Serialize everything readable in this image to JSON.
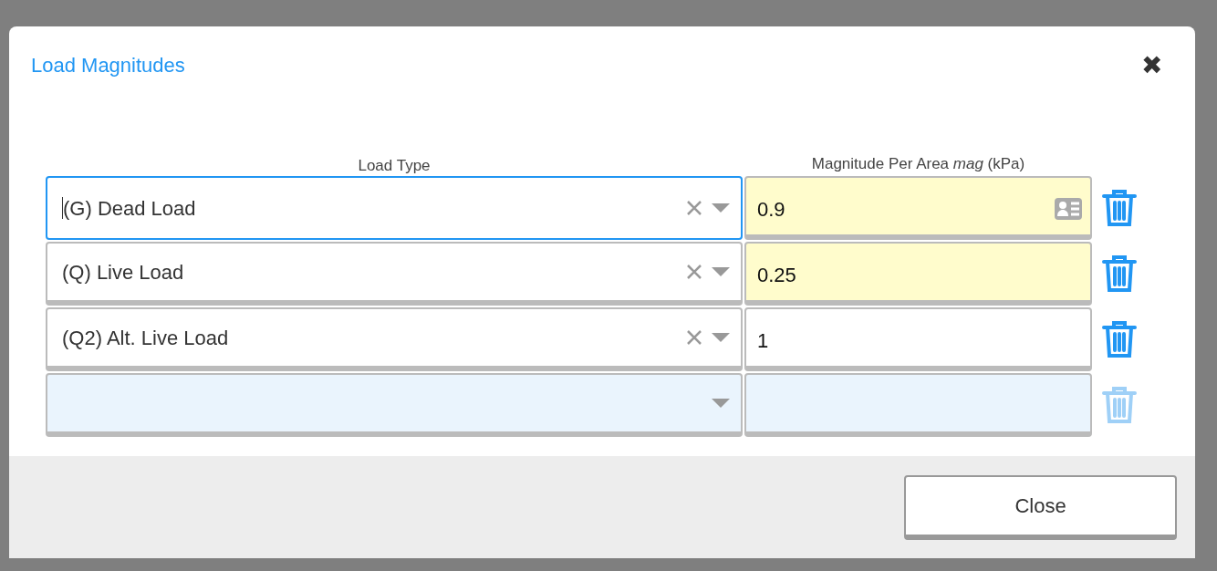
{
  "dialog": {
    "title": "Load Magnitudes",
    "close_icon": "✖"
  },
  "columns": [
    "Load Type",
    "Magnitude Per Area *mag* (kPa)"
  ],
  "rows": [
    {
      "kind": "entry",
      "load_type": "(G) Dead Load",
      "magnitude": "0.9",
      "focused": true,
      "modified": true
    },
    {
      "kind": "entry",
      "load_type": "(Q) Live Load",
      "magnitude": "0.25",
      "focused": false,
      "modified": true
    },
    {
      "kind": "entry",
      "load_type": "(Q2) Alt. Live Load",
      "magnitude": "1",
      "focused": false,
      "modified": false
    },
    {
      "kind": "new"
    }
  ],
  "footer": {
    "close_button": "Close"
  }
}
